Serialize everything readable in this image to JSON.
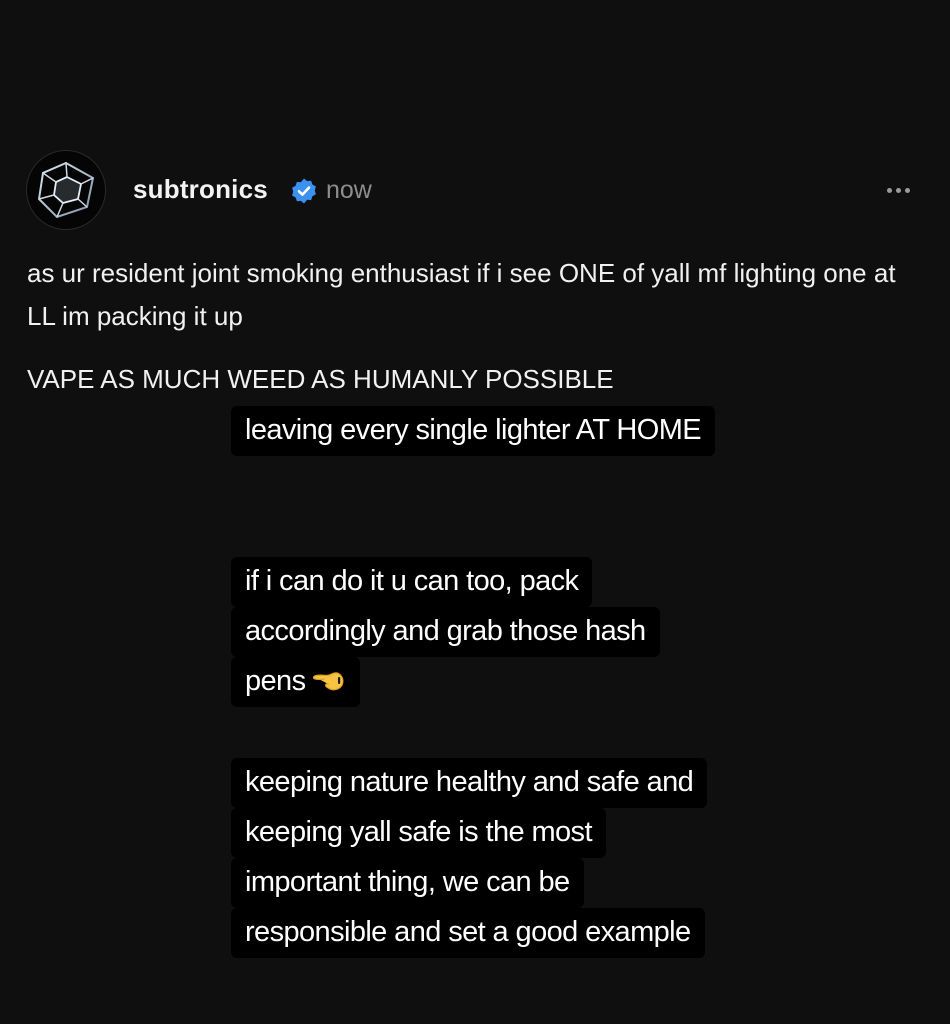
{
  "post": {
    "username": "subtronics",
    "verified": true,
    "timestamp": "now",
    "more_label": "More options",
    "text_line_1": "as ur resident joint smoking enthusiast if i see ONE of yall mf lighting one at LL im packing it up",
    "text_line_2": "VAPE AS MUCH WEED AS HUMANLY POSSIBLE"
  },
  "captions": {
    "block1": [
      "leaving every single lighter AT HOME"
    ],
    "block2": [
      "if i can do it u can too, pack",
      "accordingly and grab those hash",
      "pens"
    ],
    "block2_emoji": "backhand-index-pointing-left",
    "block3": [
      "keeping nature healthy and safe and",
      "keeping yall safe is the most",
      "important thing, we can be",
      "responsible and set a good example"
    ]
  },
  "colors": {
    "background": "#0f0f10",
    "caption_background": "#000000",
    "verified_badge": "#3a91f0",
    "muted_text": "#8d8d8d"
  }
}
